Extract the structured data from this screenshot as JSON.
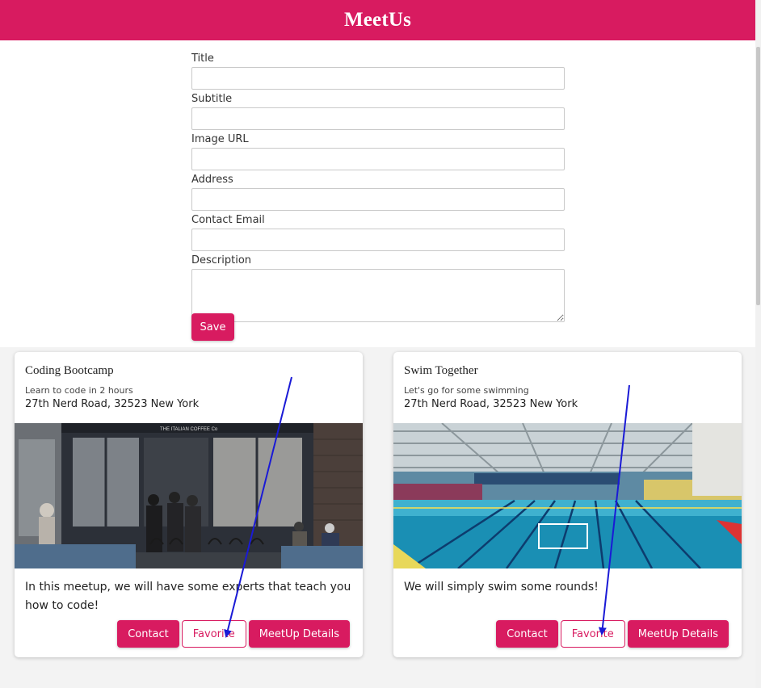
{
  "header": {
    "title": "MeetUs"
  },
  "form": {
    "fields": [
      {
        "label": "Title",
        "value": ""
      },
      {
        "label": "Subtitle",
        "value": ""
      },
      {
        "label": "Image URL",
        "value": ""
      },
      {
        "label": "Address",
        "value": ""
      },
      {
        "label": "Contact Email",
        "value": ""
      },
      {
        "label": "Description",
        "value": ""
      }
    ],
    "save_label": "Save"
  },
  "meetups": [
    {
      "title": "Coding Bootcamp",
      "subtitle": "Learn to code in 2 hours",
      "address": "27th Nerd Road, 32523 New York",
      "image": "coffee-shop-photo",
      "storefront_sign": "THE ITALIAN COFFEE Co",
      "description": "In this meetup, we will have some experts that teach you how to code!",
      "buttons": {
        "contact": "Contact",
        "favorite": "Favorite",
        "details": "MeetUp Details"
      }
    },
    {
      "title": "Swim Together",
      "subtitle": "Let's go for some swimming",
      "address": "27th Nerd Road, 32523 New York",
      "image": "swimming-pool-photo",
      "description": "We will simply swim some rounds!",
      "buttons": {
        "contact": "Contact",
        "favorite": "Favorite",
        "details": "MeetUp Details"
      }
    }
  ],
  "colors": {
    "primary": "#d81b60",
    "arrow": "#1a1ad6",
    "area_background": "#f3f3f3"
  },
  "annotations": [
    {
      "type": "arrow",
      "points_to": "Favorite"
    },
    {
      "type": "arrow",
      "points_to": "Favorite"
    }
  ]
}
